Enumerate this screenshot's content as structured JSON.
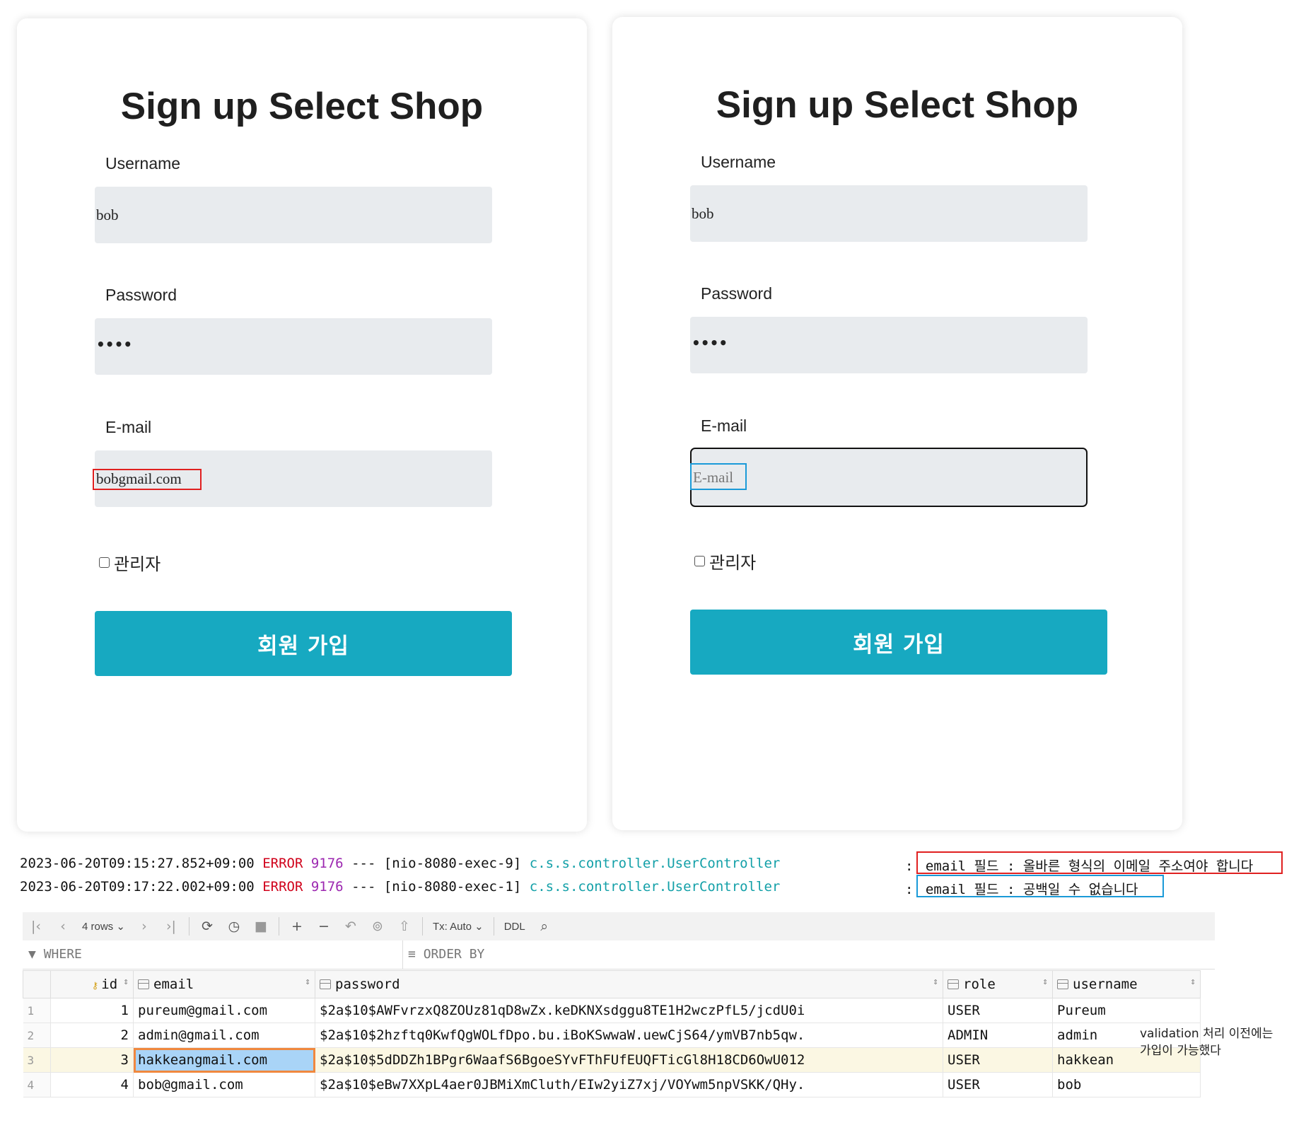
{
  "left_form": {
    "title": "Sign up Select Shop",
    "username_label": "Username",
    "username_value": "bob",
    "password_label": "Password",
    "password_value": "••••",
    "email_label": "E-mail",
    "email_value": "bobgmail.com",
    "admin_checkbox_label": "관리자",
    "admin_checked": false,
    "submit_label": "회원 가입"
  },
  "right_form": {
    "title": "Sign up Select Shop",
    "username_label": "Username",
    "username_value": "bob",
    "password_label": "Password",
    "password_value": "••••",
    "email_label": "E-mail",
    "email_placeholder": "E-mail",
    "admin_checkbox_label": "관리자",
    "admin_checked": false,
    "submit_label": "회원 가입"
  },
  "logs": [
    {
      "timestamp": "2023-06-20T09:15:27.852+09:00",
      "level": "ERROR",
      "pid": "9176",
      "sep": "---",
      "thread": "[nio-8080-exec-9]",
      "logger": "c.s.s.controller.UserController",
      "colon": ":",
      "message": "email 필드 : 올바른 형식의 이메일 주소여야 합니다"
    },
    {
      "timestamp": "2023-06-20T09:17:22.002+09:00",
      "level": "ERROR",
      "pid": "9176",
      "sep": "---",
      "thread": "[nio-8080-exec-1]",
      "logger": "c.s.s.controller.UserController",
      "colon": ":",
      "message": "email 필드 : 공백일 수 없습니다"
    }
  ],
  "toolbar": {
    "rows_label": "4 rows",
    "tx_label": "Tx: Auto",
    "ddl_label": "DDL"
  },
  "filter": {
    "where_label": "WHERE",
    "order_label": "ORDER BY"
  },
  "table": {
    "columns": [
      "id",
      "email",
      "password",
      "role",
      "username"
    ],
    "rows": [
      {
        "rownum": "1",
        "id": "1",
        "email": "pureum@gmail.com",
        "password": "$2a$10$AWFvrzxQ8ZOUz81qD8wZx.keDKNXsdggu8TE1H2wczPfL5/jcdU0i",
        "role": "USER",
        "username": "Pureum"
      },
      {
        "rownum": "2",
        "id": "2",
        "email": "admin@gmail.com",
        "password": "$2a$10$2hzftq0KwfQgWOLfDpo.bu.iBoKSwwaW.uewCjS64/ymVB7nb5qw.",
        "role": "ADMIN",
        "username": "admin"
      },
      {
        "rownum": "3",
        "id": "3",
        "email": "hakkeangmail.com",
        "password": "$2a$10$5dDDZh1BPgr6WaafS6BgoeSYvFThFUfEUQFTicGl8H18CD6OwU012",
        "role": "USER",
        "username": "hakkean"
      },
      {
        "rownum": "4",
        "id": "4",
        "email": "bob@gmail.com",
        "password": "$2a$10$eBw7XXpL4aer0JBMiXmCluth/EIw2yiZ7xj/VOYwm5npVSKK/QHy.",
        "role": "USER",
        "username": "bob"
      }
    ]
  },
  "note": {
    "line1": "validation 처리 이전에는",
    "line2": "가입이 가능했다"
  },
  "colors": {
    "button": "#17a9c1",
    "input_bg": "#e8ebee",
    "highlight_red": "#e02020",
    "highlight_blue": "#1a9ad8",
    "cell_highlight": "#a9d4f7",
    "cell_outline": "#f0883e"
  }
}
